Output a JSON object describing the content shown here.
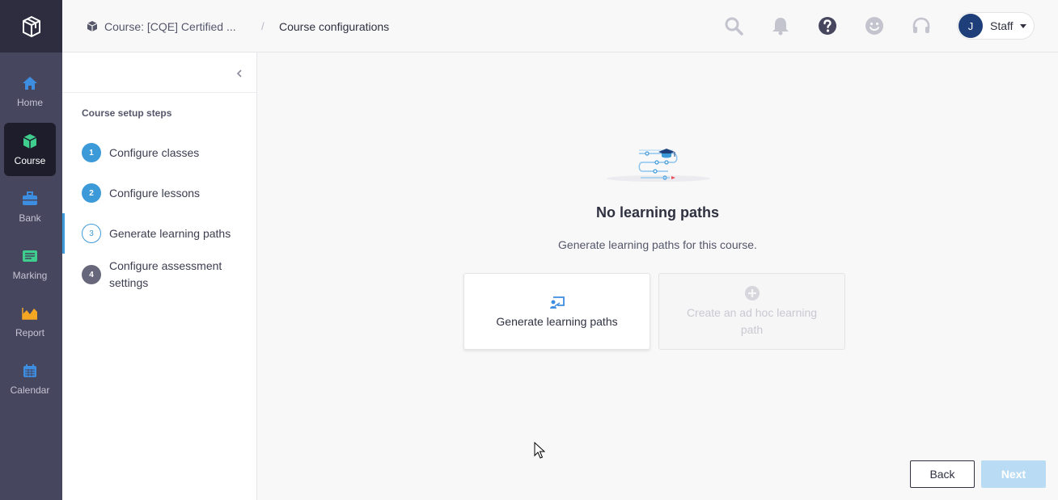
{
  "nav": {
    "items": [
      {
        "label": "Home",
        "icon": "home-icon"
      },
      {
        "label": "Course",
        "icon": "cube-icon",
        "active": true
      },
      {
        "label": "Bank",
        "icon": "briefcase-icon"
      },
      {
        "label": "Marking",
        "icon": "marking-icon"
      },
      {
        "label": "Report",
        "icon": "chart-icon"
      },
      {
        "label": "Calendar",
        "icon": "calendar-icon"
      }
    ]
  },
  "header": {
    "breadcrumb_course": "Course: [CQE] Certified ...",
    "breadcrumb_separator": "/",
    "breadcrumb_current": "Course configurations",
    "user_initial": "J",
    "user_role": "Staff"
  },
  "steps": {
    "title": "Course setup steps",
    "items": [
      {
        "number": "1",
        "label": "Configure classes",
        "state": "done"
      },
      {
        "number": "2",
        "label": "Configure lessons",
        "state": "done"
      },
      {
        "number": "3",
        "label": "Generate learning paths",
        "state": "current"
      },
      {
        "number": "4",
        "label": "Configure assessment settings",
        "state": "pending"
      }
    ]
  },
  "main": {
    "empty_title": "No learning paths",
    "empty_subtitle": "Generate learning paths for this course.",
    "generate_card_label": "Generate learning paths",
    "adhoc_card_label": "Create an ad hoc learning path",
    "back_label": "Back",
    "next_label": "Next"
  },
  "colors": {
    "rail": "#47465f",
    "accent": "#3d9ad9",
    "next_disabled": "#b9dcf4"
  }
}
